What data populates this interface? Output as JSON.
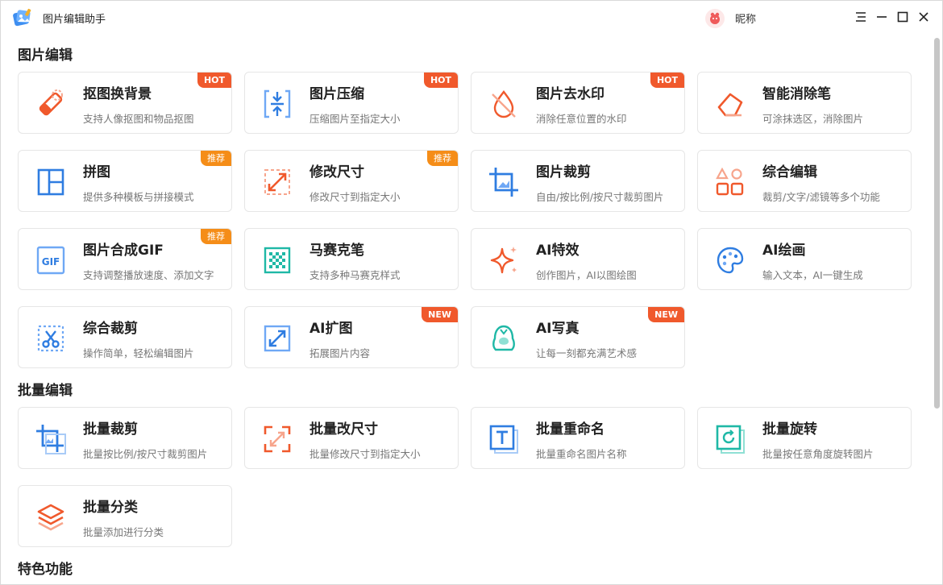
{
  "app": {
    "title": "图片编辑助手",
    "user_name": "昵称"
  },
  "sections": [
    {
      "title": "图片编辑",
      "cards": [
        {
          "title": "抠图换背景",
          "desc": "支持人像抠图和物品抠图",
          "badge": "HOT",
          "icon": "eraser-icon"
        },
        {
          "title": "图片压缩",
          "desc": "压缩图片至指定大小",
          "badge": "HOT",
          "icon": "compress-icon"
        },
        {
          "title": "图片去水印",
          "desc": "消除任意位置的水印",
          "badge": "HOT",
          "icon": "no-water-drop-icon"
        },
        {
          "title": "智能消除笔",
          "desc": "可涂抹选区，消除图片",
          "badge": "",
          "icon": "eraser-pen-icon"
        },
        {
          "title": "拼图",
          "desc": "提供多种模板与拼接模式",
          "badge": "推荐",
          "icon": "collage-icon"
        },
        {
          "title": "修改尺寸",
          "desc": "修改尺寸到指定大小",
          "badge": "推荐",
          "icon": "resize-icon"
        },
        {
          "title": "图片裁剪",
          "desc": "自由/按比例/按尺寸裁剪图片",
          "badge": "",
          "icon": "crop-icon"
        },
        {
          "title": "综合编辑",
          "desc": "裁剪/文字/滤镜等多个功能",
          "badge": "",
          "icon": "shapes-icon"
        },
        {
          "title": "图片合成GIF",
          "desc": "支持调整播放速度、添加文字",
          "badge": "推荐",
          "icon": "gif-icon",
          "icon_text": "GIF"
        },
        {
          "title": "马赛克笔",
          "desc": "支持多种马赛克样式",
          "badge": "",
          "icon": "mosaic-icon"
        },
        {
          "title": "AI特效",
          "desc": "创作图片，AI以图绘图",
          "badge": "",
          "icon": "sparkle-icon"
        },
        {
          "title": "AI绘画",
          "desc": "输入文本，AI一键生成",
          "badge": "",
          "icon": "palette-icon"
        },
        {
          "title": "综合裁剪",
          "desc": "操作简单，轻松编辑图片",
          "badge": "",
          "icon": "scissors-icon"
        },
        {
          "title": "AI扩图",
          "desc": "拓展图片内容",
          "badge": "NEW",
          "icon": "expand-icon"
        },
        {
          "title": "AI写真",
          "desc": "让每一刻都充满艺术感",
          "badge": "NEW",
          "icon": "portrait-icon"
        }
      ]
    },
    {
      "title": "批量编辑",
      "cards": [
        {
          "title": "批量裁剪",
          "desc": "批量按比例/按尺寸裁剪图片",
          "badge": "",
          "icon": "batch-crop-icon"
        },
        {
          "title": "批量改尺寸",
          "desc": "批量修改尺寸到指定大小",
          "badge": "",
          "icon": "batch-resize-icon"
        },
        {
          "title": "批量重命名",
          "desc": "批量重命名图片名称",
          "badge": "",
          "icon": "rename-icon"
        },
        {
          "title": "批量旋转",
          "desc": "批量按任意角度旋转图片",
          "badge": "",
          "icon": "rotate-icon"
        },
        {
          "title": "批量分类",
          "desc": "批量添加进行分类",
          "badge": "",
          "icon": "layers-icon"
        }
      ]
    },
    {
      "title": "特色功能",
      "cards": []
    }
  ],
  "colors": {
    "blue": "#2f7de1",
    "orange": "#f0592c",
    "recommend": "#f58d18",
    "teal": "#1fb8a6"
  }
}
